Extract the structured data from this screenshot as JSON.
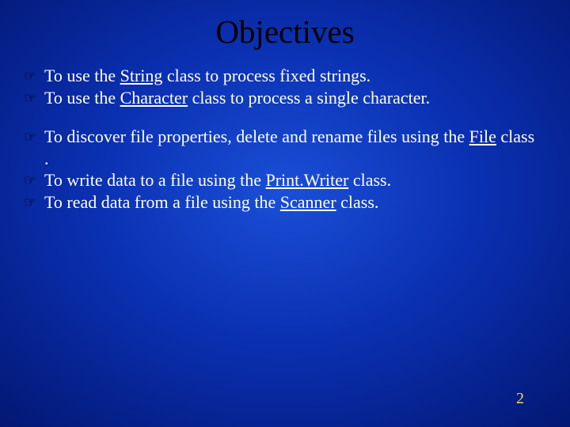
{
  "title": "Objectives",
  "groups": [
    {
      "items": [
        {
          "pre": "To use the ",
          "u": "String",
          "post": " class to process fixed strings."
        },
        {
          "pre": "To use the ",
          "u": "Character",
          "post": " class to process a single character."
        }
      ]
    },
    {
      "items": [
        {
          "pre": "To discover file properties, delete and rename files using the ",
          "u": "File",
          "post": " class ."
        },
        {
          "pre": "To write data to a file using the ",
          "u": "Print.Writer",
          "post": " class."
        },
        {
          "pre": "To read data from a file using the ",
          "u": "Scanner",
          "post": " class."
        }
      ]
    }
  ],
  "page_number": "2",
  "bullet_glyph": "☞"
}
